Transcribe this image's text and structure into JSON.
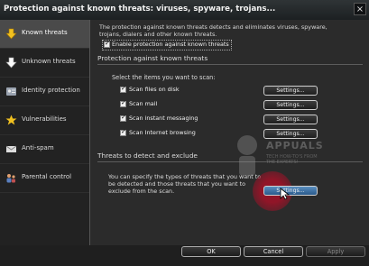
{
  "window": {
    "title": "Protection against known threats: viruses, spyware, trojans..."
  },
  "sidebar": {
    "items": [
      {
        "label": "Known threats",
        "icon": "arrow-down-icon",
        "active": true
      },
      {
        "label": "Unknown threats",
        "icon": "arrow-down-icon",
        "active": false
      },
      {
        "label": "Identity protection",
        "icon": "id-card-icon",
        "active": false
      },
      {
        "label": "Vulnerabilities",
        "icon": "star-icon",
        "active": false
      },
      {
        "label": "Anti-spam",
        "icon": "envelope-icon",
        "active": false
      },
      {
        "label": "Parental control",
        "icon": "people-icon",
        "active": false
      }
    ]
  },
  "main": {
    "description": "The protection against known threats detects and eliminates viruses, spyware, trojans, dialers and other known threats.",
    "enable_label": "Enable protection against known threats",
    "section1_title": "Protection against known threats",
    "select_label": "Select the items you want to scan:",
    "scan_items": [
      {
        "label": "Scan files on disk",
        "checked": true,
        "button": "Settings..."
      },
      {
        "label": "Scan mail",
        "checked": true,
        "button": "Settings..."
      },
      {
        "label": "Scan instant messaging",
        "checked": true,
        "button": "Settings..."
      },
      {
        "label": "Scan Internet browsing",
        "checked": true,
        "button": "Settings..."
      }
    ],
    "section2_title": "Threats to detect and exclude",
    "exclude_text": "You can specify the types of threats that you want to be detected and those threats that you want to exclude from the scan.",
    "exclude_button": "Settings..."
  },
  "watermark": {
    "title": "APPUALS",
    "subtitle": "TECH HOW-TO'S FROM THE EXPERTS!"
  },
  "footer": {
    "ok": "OK",
    "cancel": "Cancel",
    "apply": "Apply"
  },
  "colors": {
    "active_item": "#4a4a4a",
    "highlight": "#961428",
    "exclude_button": "#3a73a8"
  }
}
